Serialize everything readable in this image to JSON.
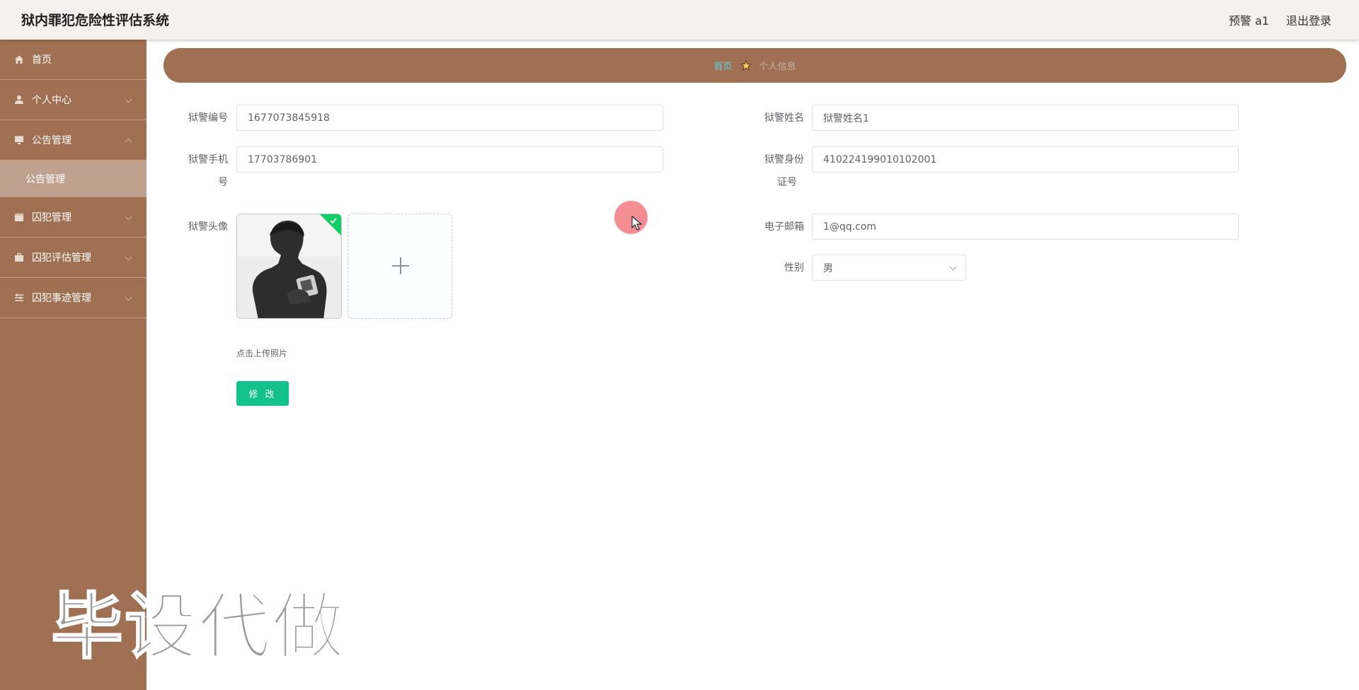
{
  "header": {
    "app_title": "狱内罪犯危险性评估系统",
    "user_label": "预警 a1",
    "logout_label": "退出登录"
  },
  "sidebar": {
    "items": [
      {
        "label": "首页",
        "icon": "home-icon"
      },
      {
        "label": "个人中心",
        "icon": "user-icon"
      },
      {
        "label": "公告管理",
        "icon": "monitor-icon",
        "expanded": true
      },
      {
        "label": "囚犯管理",
        "icon": "calendar-icon"
      },
      {
        "label": "囚犯评估管理",
        "icon": "briefcase-icon"
      },
      {
        "label": "囚犯事迹管理",
        "icon": "sliders-icon"
      }
    ],
    "sub_item": "公告管理"
  },
  "breadcrumb": {
    "home": "首页",
    "separator_icon": "star-icon",
    "current": "个人信息"
  },
  "form": {
    "number_label": "狱警编号",
    "number_value": "1677073845918",
    "name_label": "狱警姓名",
    "name_value": "狱警姓名1",
    "phone_label_line1": "狱警手机",
    "phone_label_line2": "号",
    "phone_value": "17703786901",
    "idcard_label_line1": "狱警身份",
    "idcard_label_line2": "证号",
    "idcard_value": "410224199010102001",
    "avatar_label": "狱警头像",
    "email_label": "电子邮箱",
    "email_value": "1@qq.com",
    "gender_label": "性别",
    "gender_value": "男",
    "upload_hint": "点击上传照片",
    "submit_label": "修 改"
  },
  "watermark": "毕设代做",
  "colors": {
    "sidebar_bg": "#a07052",
    "submenu_active_bg": "#c0a190",
    "breadcrumb_home": "#5dd3e6",
    "button_green": "#13c18a"
  }
}
